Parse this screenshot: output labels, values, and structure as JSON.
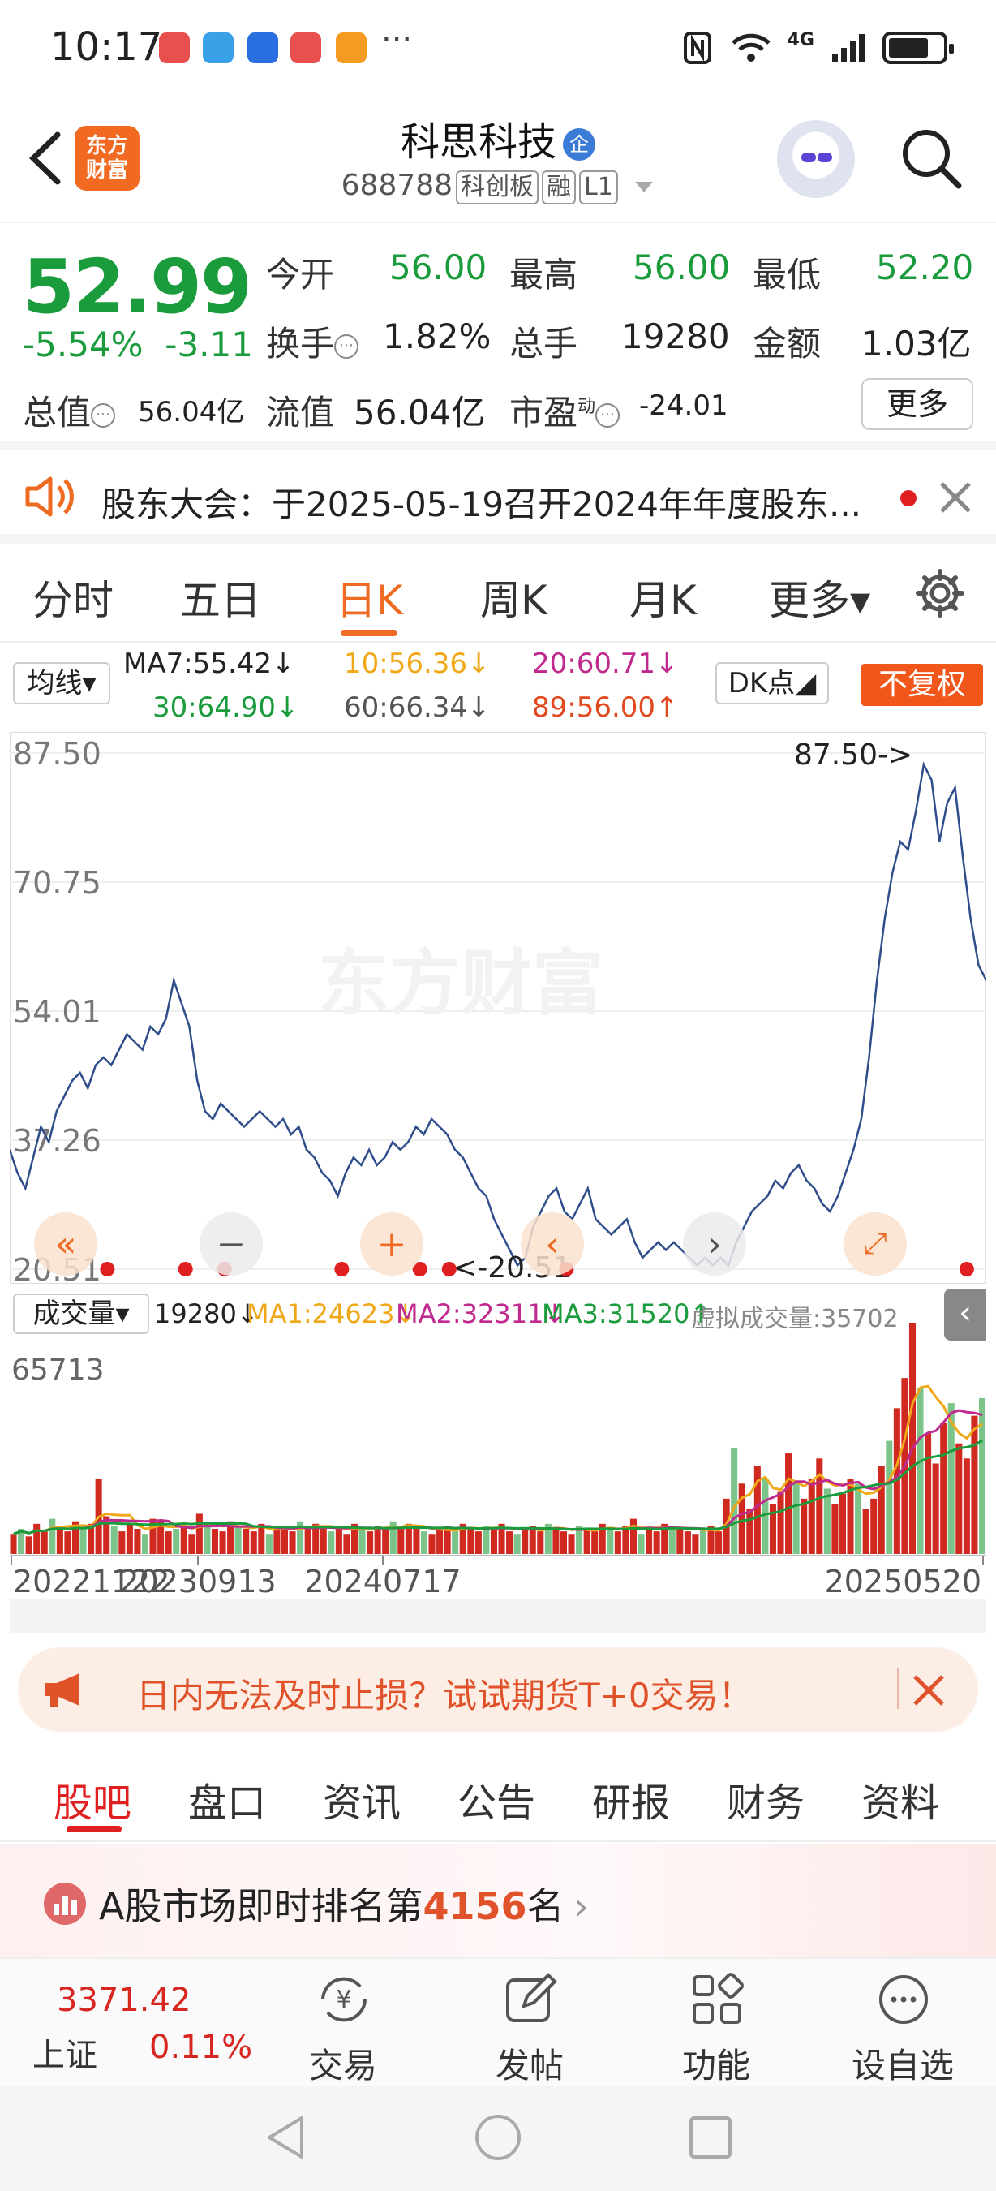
{
  "status_bar": {
    "time": "10:17",
    "more": "···",
    "network": "4G"
  },
  "header": {
    "logo_text": "东方\n财富",
    "stock_name": "科思科技",
    "qi_badge": "企",
    "stock_code": "688788",
    "tags": [
      "科创板",
      "融",
      "L1"
    ]
  },
  "quote": {
    "price": "52.99",
    "change_pct": "-5.54%",
    "change_amt": "-3.11",
    "fields": {
      "open_label": "今开",
      "open": "56.00",
      "high_label": "最高",
      "high": "56.00",
      "low_label": "最低",
      "low": "52.20",
      "turnover_label": "换手",
      "turnover": "1.82%",
      "volume_label": "总手",
      "volume": "19280",
      "amount_label": "金额",
      "amount": "1.03亿",
      "total_mv_label": "总值",
      "total_mv": "56.04亿",
      "float_mv_label": "流值",
      "float_mv": "56.04亿",
      "pe_label": "市盈",
      "pe_sup": "动",
      "pe": "-24.01"
    },
    "more_button": "更多"
  },
  "notice": {
    "text": "股东大会：于2025-05-19召开2024年年度股东..."
  },
  "chart_tabs": [
    "分时",
    "五日",
    "日K",
    "周K",
    "月K",
    "更多▾"
  ],
  "ma_row": {
    "selector": "均线▾",
    "ma7": "MA7:55.42↓",
    "ma10": "10:56.36↓",
    "ma20": "20:60.71↓",
    "ma30": "30:64.90↓",
    "ma60": "60:66.34↓",
    "ma89": "89:56.00↑",
    "dk_button": "DK点◢",
    "fuquan_button": "不复权"
  },
  "chart_data": [
    {
      "type": "line",
      "title": "日K",
      "y_ticks": [
        "87.50",
        "70.75",
        "54.01",
        "37.26",
        "20.51"
      ],
      "ylim": [
        20.51,
        87.5
      ],
      "max_annotation": "87.50->",
      "min_annotation": "<-20.51",
      "watermark": "东方财富",
      "series": [
        {
          "name": "close",
          "values": [
            36,
            33,
            31,
            35,
            39,
            37,
            41,
            43,
            45,
            46,
            44,
            47,
            48,
            47,
            49,
            51,
            50,
            49,
            52,
            51,
            53,
            58,
            55,
            52,
            45,
            41,
            40,
            42,
            41,
            40,
            39,
            40,
            41,
            40,
            39,
            40,
            38,
            39,
            36,
            35,
            33,
            32,
            30,
            33,
            35,
            34,
            36,
            34,
            35,
            37,
            36,
            37,
            39,
            38,
            40,
            39,
            38,
            36,
            35,
            33,
            31,
            30,
            27,
            25,
            23,
            21,
            22,
            26,
            28,
            30,
            31,
            28,
            27,
            29,
            31,
            27,
            26,
            25,
            26,
            27,
            24,
            22,
            23,
            24,
            23,
            24,
            23,
            22,
            21,
            22,
            21,
            22,
            21,
            24,
            26,
            28,
            29,
            30,
            32,
            31,
            33,
            34,
            32,
            31,
            29,
            28,
            30,
            33,
            36,
            40,
            48,
            58,
            66,
            72,
            76,
            75,
            80,
            86,
            84,
            76,
            81,
            83,
            74,
            66,
            60,
            58
          ]
        }
      ]
    },
    {
      "type": "bar",
      "title": "成交量",
      "y_ticks": [
        "65713"
      ],
      "x_ticks": [
        "20221122",
        "20230913",
        "20240717",
        "20250520"
      ],
      "volume_today": "19280↓",
      "ma1": "MA1:24623↓",
      "ma2": "MA2:32311↓",
      "ma3": "MA3:31520↑",
      "virtual_volume": "虚拟成交量:35702",
      "series": [
        {
          "name": "volume",
          "values": [
            8,
            10,
            7,
            12,
            9,
            14,
            11,
            9,
            13,
            10,
            12,
            30,
            15,
            11,
            9,
            12,
            10,
            8,
            14,
            13,
            9,
            10,
            11,
            8,
            16,
            12,
            10,
            9,
            13,
            11,
            10,
            9,
            12,
            8,
            10,
            11,
            9,
            13,
            10,
            12,
            11,
            9,
            10,
            8,
            12,
            10,
            9,
            11,
            10,
            13,
            11,
            12,
            10,
            9,
            8,
            10,
            11,
            9,
            12,
            10,
            9,
            11,
            10,
            12,
            9,
            8,
            10,
            11,
            9,
            12,
            10,
            9,
            8,
            11,
            10,
            9,
            12,
            10,
            9,
            11,
            14,
            8,
            10,
            9,
            12,
            11,
            10,
            9,
            8,
            10,
            11,
            9,
            22,
            42,
            28,
            18,
            35,
            30,
            20,
            25,
            40,
            28,
            22,
            30,
            38,
            26,
            20,
            24,
            30,
            28,
            18,
            22,
            35,
            45,
            58,
            70,
            92,
            66,
            48,
            36,
            52,
            60,
            44,
            38,
            55,
            62
          ]
        }
      ]
    }
  ],
  "ad": {
    "text": "日内无法及时止损？试试期货T+0交易！"
  },
  "section_tabs": [
    "股吧",
    "盘口",
    "资讯",
    "公告",
    "研报",
    "财务",
    "资料"
  ],
  "rank": {
    "prefix": "A股市场即时排名第",
    "rank": "4156",
    "suffix": "名",
    "arrow": "›"
  },
  "bottom_nav": {
    "index_value": "3371.42",
    "index_name": "上证",
    "index_change": "0.11%",
    "items": [
      "交易",
      "发帖",
      "功能",
      "设自选"
    ]
  },
  "colors": {
    "accent": "#ef6a23",
    "down": "#1a9b3c",
    "up": "#d7261f",
    "line": "#2e4d8a"
  }
}
